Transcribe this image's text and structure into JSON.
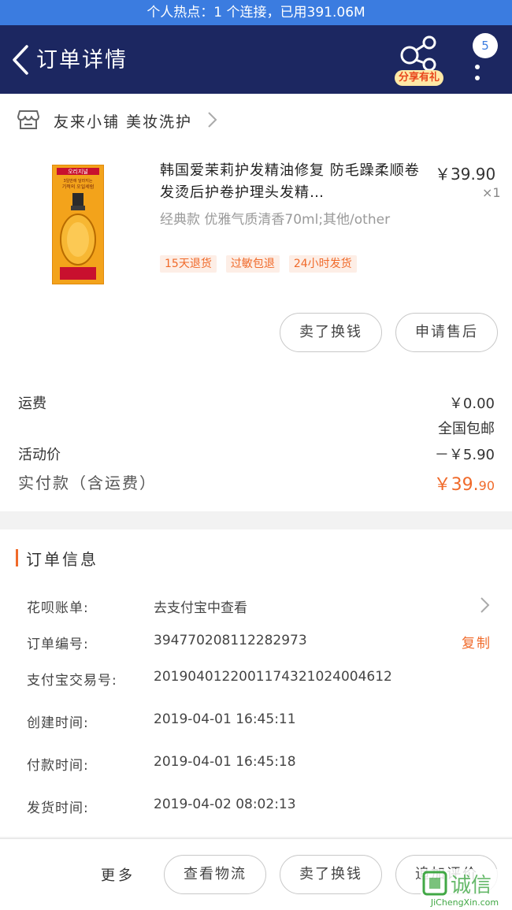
{
  "status_bar": {
    "hotspot_text": "个人热点：1 个连接，已用391.06M"
  },
  "nav": {
    "title": "订单详情",
    "share_label": "分享有礼",
    "message_count": "5"
  },
  "shop": {
    "name": "友来小铺 美妆洗护"
  },
  "product": {
    "title": "韩国爱茉莉护发精油修复 防毛躁柔顺卷发烫后护卷护理头发精…",
    "price": "￥39.90",
    "quantity": "×1",
    "spec": "经典款 优雅气质清香70ml;其他/other",
    "tags": [
      "15天退货",
      "过敏包退",
      "24小时发货"
    ],
    "image_text": {
      "line1": "오리지널",
      "line2": "3일만에 달라지는",
      "line3": "기적의 오일세럼"
    }
  },
  "actions": {
    "resell_label": "卖了换钱",
    "after_sale_label": "申请售后"
  },
  "fees": {
    "shipping_label": "运费",
    "shipping_value": "￥0.00",
    "shipping_note": "全国包邮",
    "discount_label": "活动价",
    "discount_value": "－￥5.90",
    "paid_label": "实付款（含运费）",
    "paid_int": "￥39.",
    "paid_dec": "90"
  },
  "order_info": {
    "section_title": "订单信息",
    "rows": [
      {
        "label": "花呗账单:",
        "value": "去支付宝中查看"
      },
      {
        "label": "订单编号:",
        "value": "394770208112282973"
      },
      {
        "label": "支付宝交易号:",
        "value": "2019040122001174321024004612"
      },
      {
        "label": "创建时间:",
        "value": "2019-04-01 16:45:11"
      },
      {
        "label": "付款时间:",
        "value": "2019-04-01 16:45:18"
      },
      {
        "label": "发货时间:",
        "value": "2019-04-02 08:02:13"
      }
    ],
    "copy_label": "复制"
  },
  "bottom": {
    "more_label": "更多",
    "logistics_label": "查看物流",
    "resell_label": "卖了换钱",
    "review_label": "追加评价"
  },
  "watermark": {
    "text": "诚信",
    "url": "JiChengXin.com"
  },
  "colors": {
    "nav_bg": "#1c2761",
    "status_bg": "#3b7ce0",
    "accent": "#f06a2a"
  }
}
